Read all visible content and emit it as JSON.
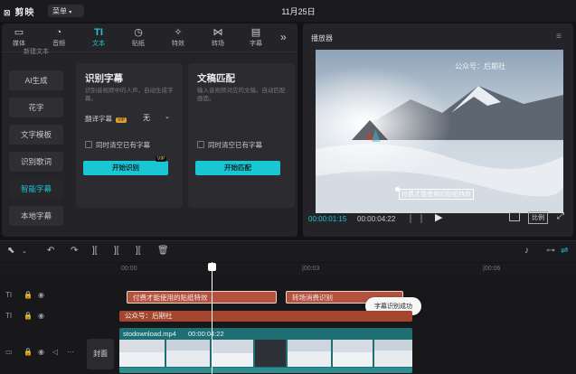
{
  "title_bar": {
    "logo": "剪映",
    "menu_label": "菜单",
    "date": "11月25日"
  },
  "top_tabs": [
    {
      "icon": "media-icon",
      "label": "媒体"
    },
    {
      "icon": "audio-icon",
      "label": "音频"
    },
    {
      "icon": "text-icon",
      "label": "文本",
      "active": true
    },
    {
      "icon": "sticker-icon",
      "label": "贴纸"
    },
    {
      "icon": "effects-icon",
      "label": "特效"
    },
    {
      "icon": "transition-icon",
      "label": "转场"
    },
    {
      "icon": "subtitle-icon",
      "label": "字幕"
    }
  ],
  "sidebar": {
    "items": [
      {
        "label": "新建文本"
      },
      {
        "label": "AI生成"
      },
      {
        "label": "花字"
      },
      {
        "label": "文字模板"
      },
      {
        "label": "识别歌词"
      },
      {
        "label": "智能字幕",
        "active": true
      },
      {
        "label": "本地字幕"
      }
    ]
  },
  "card_recognize": {
    "title": "识别字幕",
    "desc": "识别音视频中的人声，自动生成字幕。",
    "translate_label": "翻译字幕",
    "translate_value": "无",
    "clear_label": "同时清空已有字幕",
    "button": "开始识别",
    "badge": "VIP"
  },
  "card_match": {
    "title": "文稿匹配",
    "desc": "输入音视频对应的文稿，自动匹配画面。",
    "clear_label": "同时清空已有字幕",
    "button": "开始匹配"
  },
  "player": {
    "title": "播放器",
    "watermark": "公众号：后期社",
    "caption": "付费才能使用的贴纸特效",
    "current_time": "00:00:01:15",
    "total_time": "00:00:04:22",
    "ratio_label": "比例"
  },
  "ruler": {
    "labels": [
      "00:00",
      "|00:03",
      "|00:06"
    ]
  },
  "tracks": {
    "text_clip_1": "付费才能使用的贴纸特效",
    "text_clip_2": "转场消费识别",
    "tooltip": "字幕识别成功",
    "text_clip_3": "公众号：后期社",
    "cover_label": "封面",
    "video_clip_name": "stodownload.mp4",
    "video_clip_duration": "00:00:04:22"
  },
  "colors": {
    "accent": "#19c6d4",
    "text_clip": "#b5513f",
    "video_clip": "#1e6f73"
  }
}
